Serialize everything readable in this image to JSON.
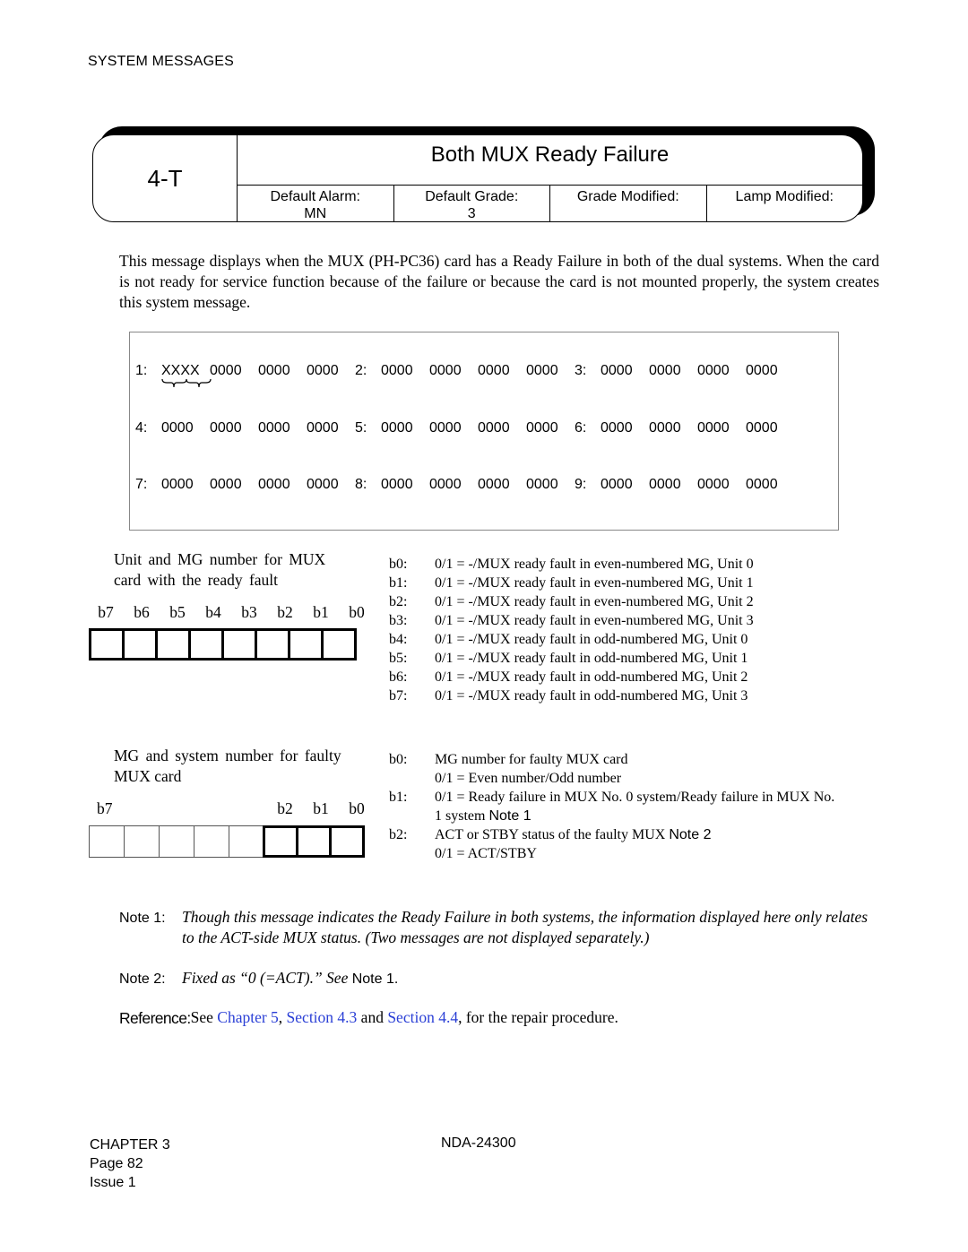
{
  "header": {
    "running_title": "SYSTEM MESSAGES"
  },
  "title_box": {
    "message_id": "4-T",
    "title": "Both MUX Ready Failure",
    "fields": [
      {
        "label": "Default Alarm:",
        "value": "MN"
      },
      {
        "label": "Default Grade:",
        "value": "3"
      },
      {
        "label": "Grade Modified:",
        "value": ""
      },
      {
        "label": "Lamp Modified:",
        "value": ""
      }
    ]
  },
  "description": "This message displays when the MUX (PH-PC36) card has a Ready Failure in both of the dual systems. When the card is not ready for service function because of the failure or because the card is not mounted properly, the system creates this system message.",
  "message_data": {
    "rows": [
      [
        {
          "label": "1:",
          "words": [
            "XXXX",
            "0000",
            "0000",
            "0000"
          ]
        },
        {
          "label": "2:",
          "words": [
            "0000",
            "0000",
            "0000",
            "0000"
          ]
        },
        {
          "label": "3:",
          "words": [
            "0000",
            "0000",
            "0000",
            "0000"
          ]
        }
      ],
      [
        {
          "label": "4:",
          "words": [
            "0000",
            "0000",
            "0000",
            "0000"
          ]
        },
        {
          "label": "5:",
          "words": [
            "0000",
            "0000",
            "0000",
            "0000"
          ]
        },
        {
          "label": "6:",
          "words": [
            "0000",
            "0000",
            "0000",
            "0000"
          ]
        }
      ],
      [
        {
          "label": "7:",
          "words": [
            "0000",
            "0000",
            "0000",
            "0000"
          ]
        },
        {
          "label": "8:",
          "words": [
            "0000",
            "0000",
            "0000",
            "0000"
          ]
        },
        {
          "label": "9:",
          "words": [
            "0000",
            "0000",
            "0000",
            "0000"
          ]
        }
      ]
    ]
  },
  "bit_table_1": {
    "caption_line1": "Unit and MG number for MUX",
    "caption_line2": "card with the ready fault",
    "bit_labels": [
      "b7",
      "b6",
      "b5",
      "b4",
      "b3",
      "b2",
      "b1",
      "b0"
    ],
    "descriptions": [
      {
        "bit": "b0:",
        "text": "0/1 = -/MUX ready fault in even-numbered MG, Unit 0"
      },
      {
        "bit": "b1:",
        "text": "0/1 = -/MUX ready fault in even-numbered MG, Unit 1"
      },
      {
        "bit": "b2:",
        "text": "0/1 = -/MUX ready fault in even-numbered MG, Unit 2"
      },
      {
        "bit": "b3:",
        "text": "0/1 = -/MUX ready fault in even-numbered MG, Unit 3"
      },
      {
        "bit": "b4:",
        "text": "0/1 = -/MUX ready fault in odd-numbered MG, Unit 0"
      },
      {
        "bit": "b5:",
        "text": "0/1 = -/MUX ready fault in odd-numbered MG, Unit 1"
      },
      {
        "bit": "b6:",
        "text": "0/1 = -/MUX ready fault in odd-numbered MG, Unit 2"
      },
      {
        "bit": "b7:",
        "text": "0/1 = -/MUX ready fault in odd-numbered MG, Unit 3"
      }
    ]
  },
  "bit_table_2": {
    "caption_line1": "MG and system number for faulty",
    "caption_line2": "MUX card",
    "bit_label_high": "b7",
    "bit_labels_low": [
      "b2",
      "b1",
      "b0"
    ],
    "descriptions": [
      {
        "bit": "b0:",
        "text": "MG number for faulty MUX card"
      },
      {
        "bit": "",
        "text": "0/1 = Even number/Odd number"
      },
      {
        "bit": "b1:",
        "text": "0/1 = Ready failure in MUX No. 0 system/Ready failure in MUX No."
      },
      {
        "bit": "",
        "text": "1 system",
        "note_ref": "Note 1"
      },
      {
        "bit": "b2:",
        "text": "ACT or STBY status of the faulty MUX",
        "note_ref": "Note 2"
      },
      {
        "bit": "",
        "text": "0/1 = ACT/STBY"
      }
    ]
  },
  "notes": [
    {
      "label": "Note 1:",
      "text": "Though this message indicates the Ready Failure in both systems, the information displayed here only relates to the ACT-side MUX status. (Two messages are not displayed separately.)"
    },
    {
      "label": "Note 2:",
      "text": "Fixed as “0 (=ACT).” See",
      "ref": "Note 1",
      "suffix": "."
    }
  ],
  "reference": {
    "label": "Reference:",
    "prefix": "See",
    "links": [
      "Chapter 5",
      "Section 4.3",
      "Section 4.4"
    ],
    "joiner_1": ",",
    "joiner_2": "and",
    "suffix": ", for the repair procedure."
  },
  "footer": {
    "chapter": "CHAPTER 3",
    "page": "Page 82",
    "issue": "Issue 1",
    "doc_number": "NDA-24300"
  },
  "colors": {
    "link": "#2a3fd6",
    "text": "#000000"
  }
}
